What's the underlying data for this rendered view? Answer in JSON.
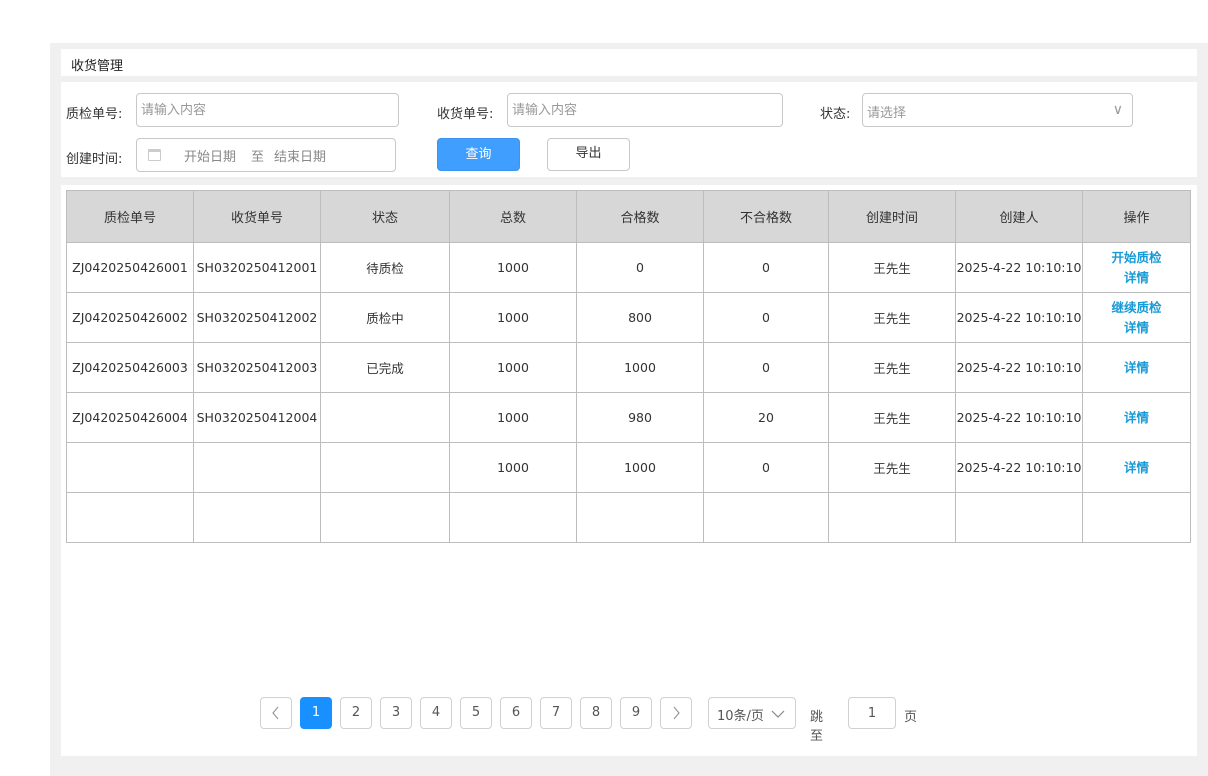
{
  "page": {
    "title": "收货管理"
  },
  "filters": {
    "qc_no_label": "质检单号:",
    "qc_no_placeholder": "请输入内容",
    "receipt_no_label": "收货单号:",
    "receipt_no_placeholder": "请输入内容",
    "status_label": "状态:",
    "status_placeholder": "请选择",
    "created_label": "创建时间:",
    "start_placeholder": "开始日期",
    "range_sep": "至",
    "end_placeholder": "结束日期",
    "query_label": "查询",
    "export_label": "导出"
  },
  "table": {
    "headers": [
      "质检单号",
      "收货单号",
      "状态",
      "总数",
      "合格数",
      "不合格数",
      "创建时间",
      "创建人",
      "操作"
    ],
    "rows": [
      {
        "qc_no": "ZJ0420250426001",
        "receipt_no": "SH0320250412001",
        "status": "待质检",
        "total": "1000",
        "passed": "0",
        "failed": "0",
        "created_time": "王先生",
        "creator": "2025-4-22 10:10:10",
        "action1": "开始质检",
        "action2": "详情"
      },
      {
        "qc_no": "ZJ0420250426002",
        "receipt_no": "SH0320250412002",
        "status": "质检中",
        "total": "1000",
        "passed": "800",
        "failed": "0",
        "created_time": "王先生",
        "creator": "2025-4-22 10:10:10",
        "action1": "继续质检",
        "action2": "详情"
      },
      {
        "qc_no": "ZJ0420250426003",
        "receipt_no": "SH0320250412003",
        "status": "已完成",
        "total": "1000",
        "passed": "1000",
        "failed": "0",
        "created_time": "王先生",
        "creator": "2025-4-22 10:10:10",
        "action1": "",
        "action2": "详情"
      },
      {
        "qc_no": "ZJ0420250426004",
        "receipt_no": "SH0320250412004",
        "status": "",
        "total": "1000",
        "passed": "980",
        "failed": "20",
        "created_time": "王先生",
        "creator": "2025-4-22 10:10:10",
        "action1": "",
        "action2": "详情"
      },
      {
        "qc_no": "",
        "receipt_no": "",
        "status": "",
        "total": "1000",
        "passed": "1000",
        "failed": "0",
        "created_time": "王先生",
        "creator": "2025-4-22 10:10:10",
        "action1": "",
        "action2": "详情"
      },
      {
        "qc_no": "",
        "receipt_no": "",
        "status": "",
        "total": "",
        "passed": "",
        "failed": "",
        "created_time": "",
        "creator": "",
        "action1": "",
        "action2": ""
      }
    ]
  },
  "pagination": {
    "prev_icon": "chevron-left-icon",
    "next_icon": "chevron-right-icon",
    "pages": [
      "1",
      "2",
      "3",
      "4",
      "5",
      "6",
      "7",
      "8",
      "9"
    ],
    "current": "1",
    "page_size": "10条/页",
    "jump_label": "跳至",
    "jump_value": "1",
    "page_suffix": "页"
  },
  "colors": {
    "primary": "#409eff",
    "link": "#1a9bd7",
    "danger": "#e3142d",
    "header_bg": "#d7d7d7"
  }
}
